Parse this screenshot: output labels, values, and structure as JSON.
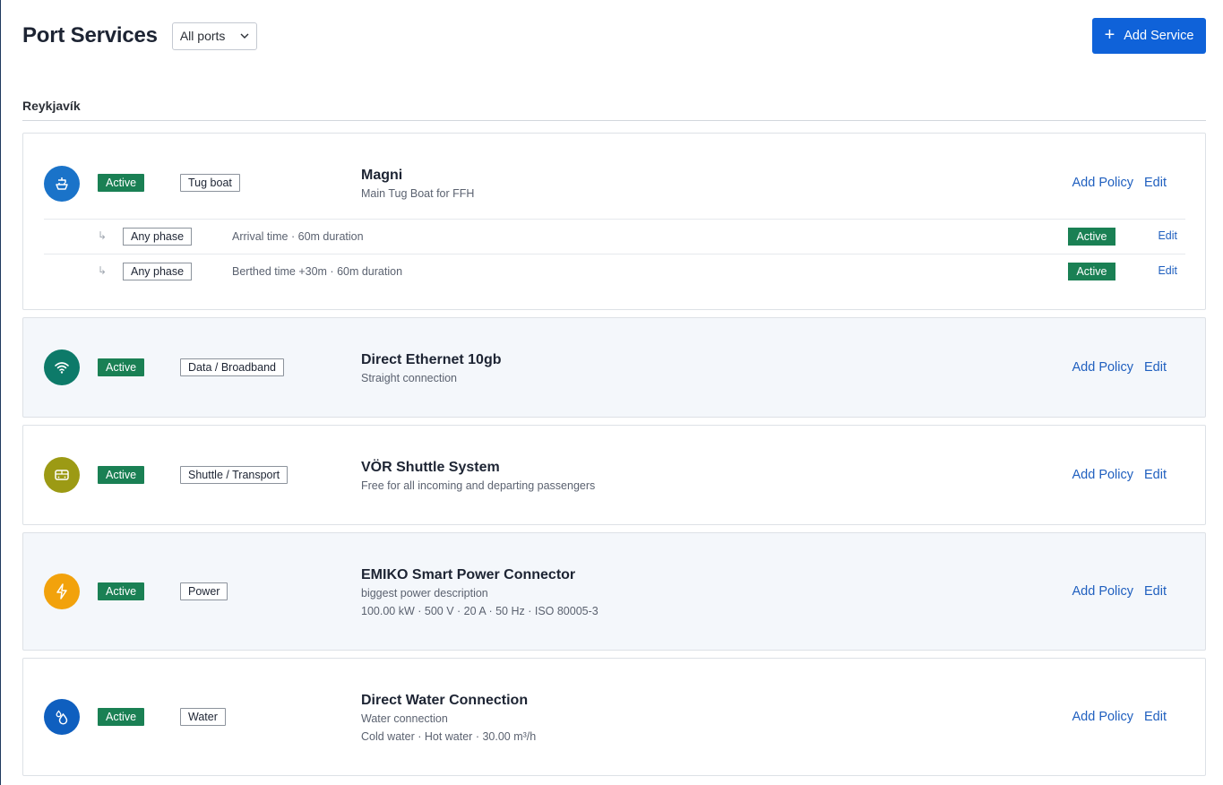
{
  "header": {
    "title": "Port Services",
    "port_filter": "All ports",
    "add_service_label": "Add Service"
  },
  "section": {
    "title": "Reykjavík"
  },
  "status_active": "Active",
  "links": {
    "add_policy": "Add Policy",
    "edit": "Edit"
  },
  "colors": {
    "primary": "#0f62d9",
    "active_badge": "#1a8054",
    "link": "#1f5fbf",
    "tug_icon_bg": "#1a73c9",
    "data_icon_bg": "#0d7a69",
    "shuttle_icon_bg": "#9c9a14",
    "power_icon_bg": "#f2a20c",
    "water_icon_bg": "#0f5fbf"
  },
  "services": [
    {
      "icon": "tug-boat-icon",
      "status": "Active",
      "category": "Tug boat",
      "name": "Magni",
      "description": "Main Tug Boat for FFH",
      "specs": "",
      "policies": [
        {
          "phase": "Any phase",
          "description": "Arrival time · 60m duration",
          "status": "Active",
          "edit": "Edit"
        },
        {
          "phase": "Any phase",
          "description": "Berthed time +30m · 60m duration",
          "status": "Active",
          "edit": "Edit"
        }
      ]
    },
    {
      "icon": "wifi-icon",
      "status": "Active",
      "category": "Data / Broadband",
      "name": "Direct Ethernet 10gb",
      "description": "Straight connection",
      "specs": ""
    },
    {
      "icon": "bus-icon",
      "status": "Active",
      "category": "Shuttle / Transport",
      "name": "VÖR Shuttle System",
      "description": "Free for all incoming and departing passengers",
      "specs": ""
    },
    {
      "icon": "lightning-icon",
      "status": "Active",
      "category": "Power",
      "name": "EMIKO Smart Power Connector",
      "description": "biggest power description",
      "specs": "100.00 kW · 500 V · 20 A · 50 Hz · ISO 80005-3"
    },
    {
      "icon": "water-drops-icon",
      "status": "Active",
      "category": "Water",
      "name": "Direct Water Connection",
      "description": "Water connection",
      "specs": "Cold water · Hot water · 30.00 m³/h"
    }
  ]
}
